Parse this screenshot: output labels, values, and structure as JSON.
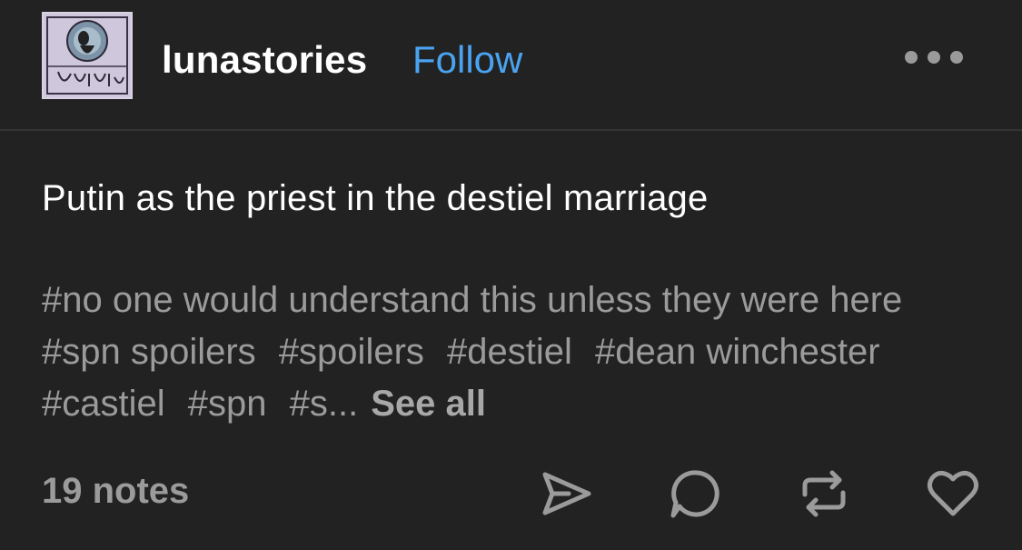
{
  "header": {
    "avatar_text": "lunastories",
    "username": "lunastories",
    "follow_label": "Follow",
    "more_icon": "more-horizontal-icon"
  },
  "post": {
    "text": "Putin as the priest in the destiel marriage"
  },
  "tags": {
    "items": [
      "#no one would understand this unless they were here",
      "#spn spoilers",
      "#spoilers",
      "#destiel",
      "#dean winchester",
      "#castiel",
      "#spn",
      "#s..."
    ],
    "see_all_label": "See all"
  },
  "footer": {
    "notes_label": "19 notes",
    "actions": [
      "share-icon",
      "reply-icon",
      "reblog-icon",
      "like-icon"
    ]
  },
  "colors": {
    "background": "#222222",
    "accent": "#4aa3f0",
    "muted_text": "#9b9b9b"
  }
}
